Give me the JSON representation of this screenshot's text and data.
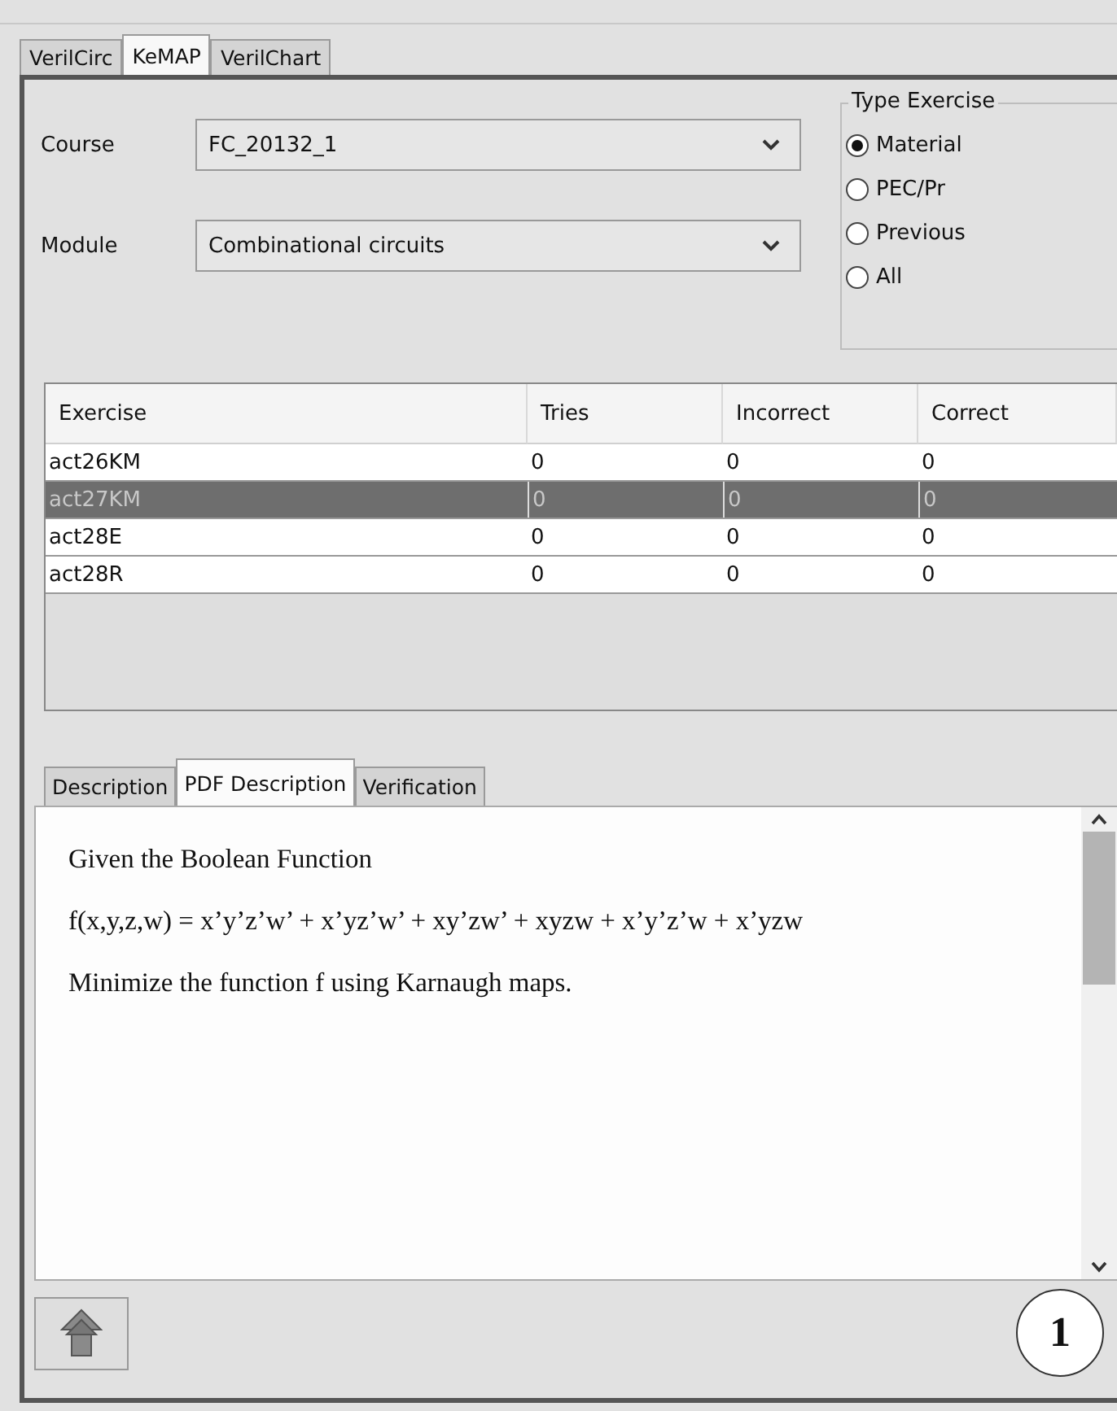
{
  "tabs": [
    {
      "label": "VerilCirc",
      "selected": false
    },
    {
      "label": "KeMAP",
      "selected": true
    },
    {
      "label": "VerilChart",
      "selected": false
    }
  ],
  "course": {
    "label": "Course",
    "value": "FC_20132_1"
  },
  "module": {
    "label": "Module",
    "value": "Combinational circuits"
  },
  "type_exercise": {
    "title": "Type Exercise",
    "options": [
      {
        "label": "Material",
        "selected": true
      },
      {
        "label": "PEC/Pr",
        "selected": false
      },
      {
        "label": "Previous",
        "selected": false
      },
      {
        "label": "All",
        "selected": false
      }
    ]
  },
  "table": {
    "columns": [
      "Exercise",
      "Tries",
      "Incorrect",
      "Correct"
    ],
    "rows": [
      {
        "cells": [
          "act26KM",
          "0",
          "0",
          "0"
        ],
        "selected": false
      },
      {
        "cells": [
          "act27KM",
          "0",
          "0",
          "0"
        ],
        "selected": true
      },
      {
        "cells": [
          "act28E",
          "0",
          "0",
          "0"
        ],
        "selected": false
      },
      {
        "cells": [
          "act28R",
          "0",
          "0",
          "0"
        ],
        "selected": false
      }
    ]
  },
  "detail_tabs": [
    {
      "label": "Description",
      "selected": false
    },
    {
      "label": "PDF Description",
      "selected": true
    },
    {
      "label": "Verification",
      "selected": false
    }
  ],
  "document": {
    "paragraphs": [
      "Given the Boolean Function",
      "f(x,y,z,w) = x’y’z’w’ + x’yz’w’ + xy’zw’ + xyzw + x’y’z’w + x’yzw",
      "Minimize the function f using Karnaugh maps."
    ]
  },
  "badge": "1"
}
